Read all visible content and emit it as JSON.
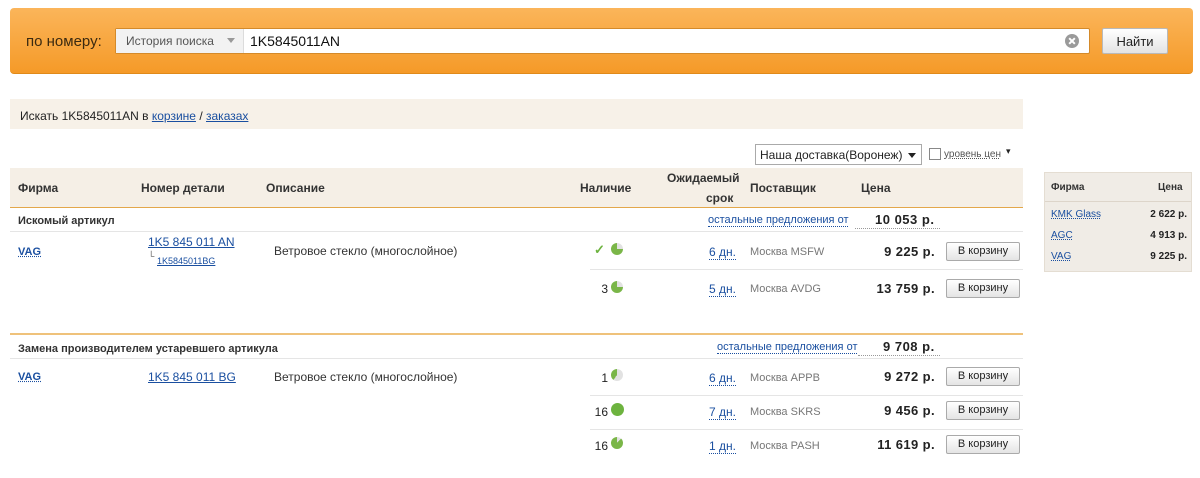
{
  "search": {
    "label": "по номеру:",
    "history_label": "История поиска",
    "query": "1K5845011AN",
    "find_button": "Найти"
  },
  "search_in": {
    "prefix": "Искать 1K5845011AN в",
    "cart_link": "корзине",
    "separator": "/",
    "orders_link": "заказах"
  },
  "delivery": {
    "selected": "Наша доставка(Воронеж)",
    "price_level_label": "уровень цен"
  },
  "table": {
    "headers": {
      "firm": "Фирма",
      "part_number": "Номер детали",
      "description": "Описание",
      "availability": "Наличие",
      "expected_1": "Ожидаемый",
      "expected_2": "срок",
      "supplier": "Поставщик",
      "price": "Цена"
    },
    "sections": [
      {
        "title": "Искомый артикул",
        "others_label": "остальные предложения от",
        "min_price": "10 053 р.",
        "firm": "VAG",
        "part_number": "1K5 845 011 AN",
        "sub_number": "1K5845011BG",
        "description": "Ветровое стекло (многослойное)",
        "rows": [
          {
            "qty": "",
            "days": "6 дн.",
            "supplier": "Москва MSFW",
            "price": "9 225 р.",
            "cart": "В корзину"
          },
          {
            "qty": "3",
            "days": "5 дн.",
            "supplier": "Москва AVDG",
            "price": "13 759 р.",
            "cart": "В корзину"
          }
        ]
      },
      {
        "title": "Замена производителем устаревшего артикула",
        "others_label": "остальные предложения от",
        "min_price": "9 708 р.",
        "firm": "VAG",
        "part_number": "1K5 845 011 BG",
        "description": "Ветровое стекло (многослойное)",
        "rows": [
          {
            "qty": "1",
            "days": "6 дн.",
            "supplier": "Москва APPB",
            "price": "9 272 р.",
            "cart": "В корзину"
          },
          {
            "qty": "16",
            "days": "7 дн.",
            "supplier": "Москва SKRS",
            "price": "9 456 р.",
            "cart": "В корзину"
          },
          {
            "qty": "16",
            "days": "1 дн.",
            "supplier": "Москва PASH",
            "price": "11 619 р.",
            "cart": "В корзину"
          }
        ]
      }
    ]
  },
  "side_panel": {
    "header_firm": "Фирма",
    "header_price": "Цена",
    "items": [
      {
        "firm": "KMK Glass",
        "price": "2 622 р."
      },
      {
        "firm": "AGC",
        "price": "4 913 р."
      },
      {
        "firm": "VAG",
        "price": "9 225 р."
      }
    ]
  },
  "icons": {
    "availability_check": "check-icon",
    "availability_pie": "pie-icon",
    "clear": "clear-icon"
  },
  "colors": {
    "search_bar": "#f7a53b",
    "link": "#1a4fa0",
    "availability_green": "#6db33f",
    "header_bg": "#f5efe6",
    "accent_line": "#e3a74a"
  }
}
